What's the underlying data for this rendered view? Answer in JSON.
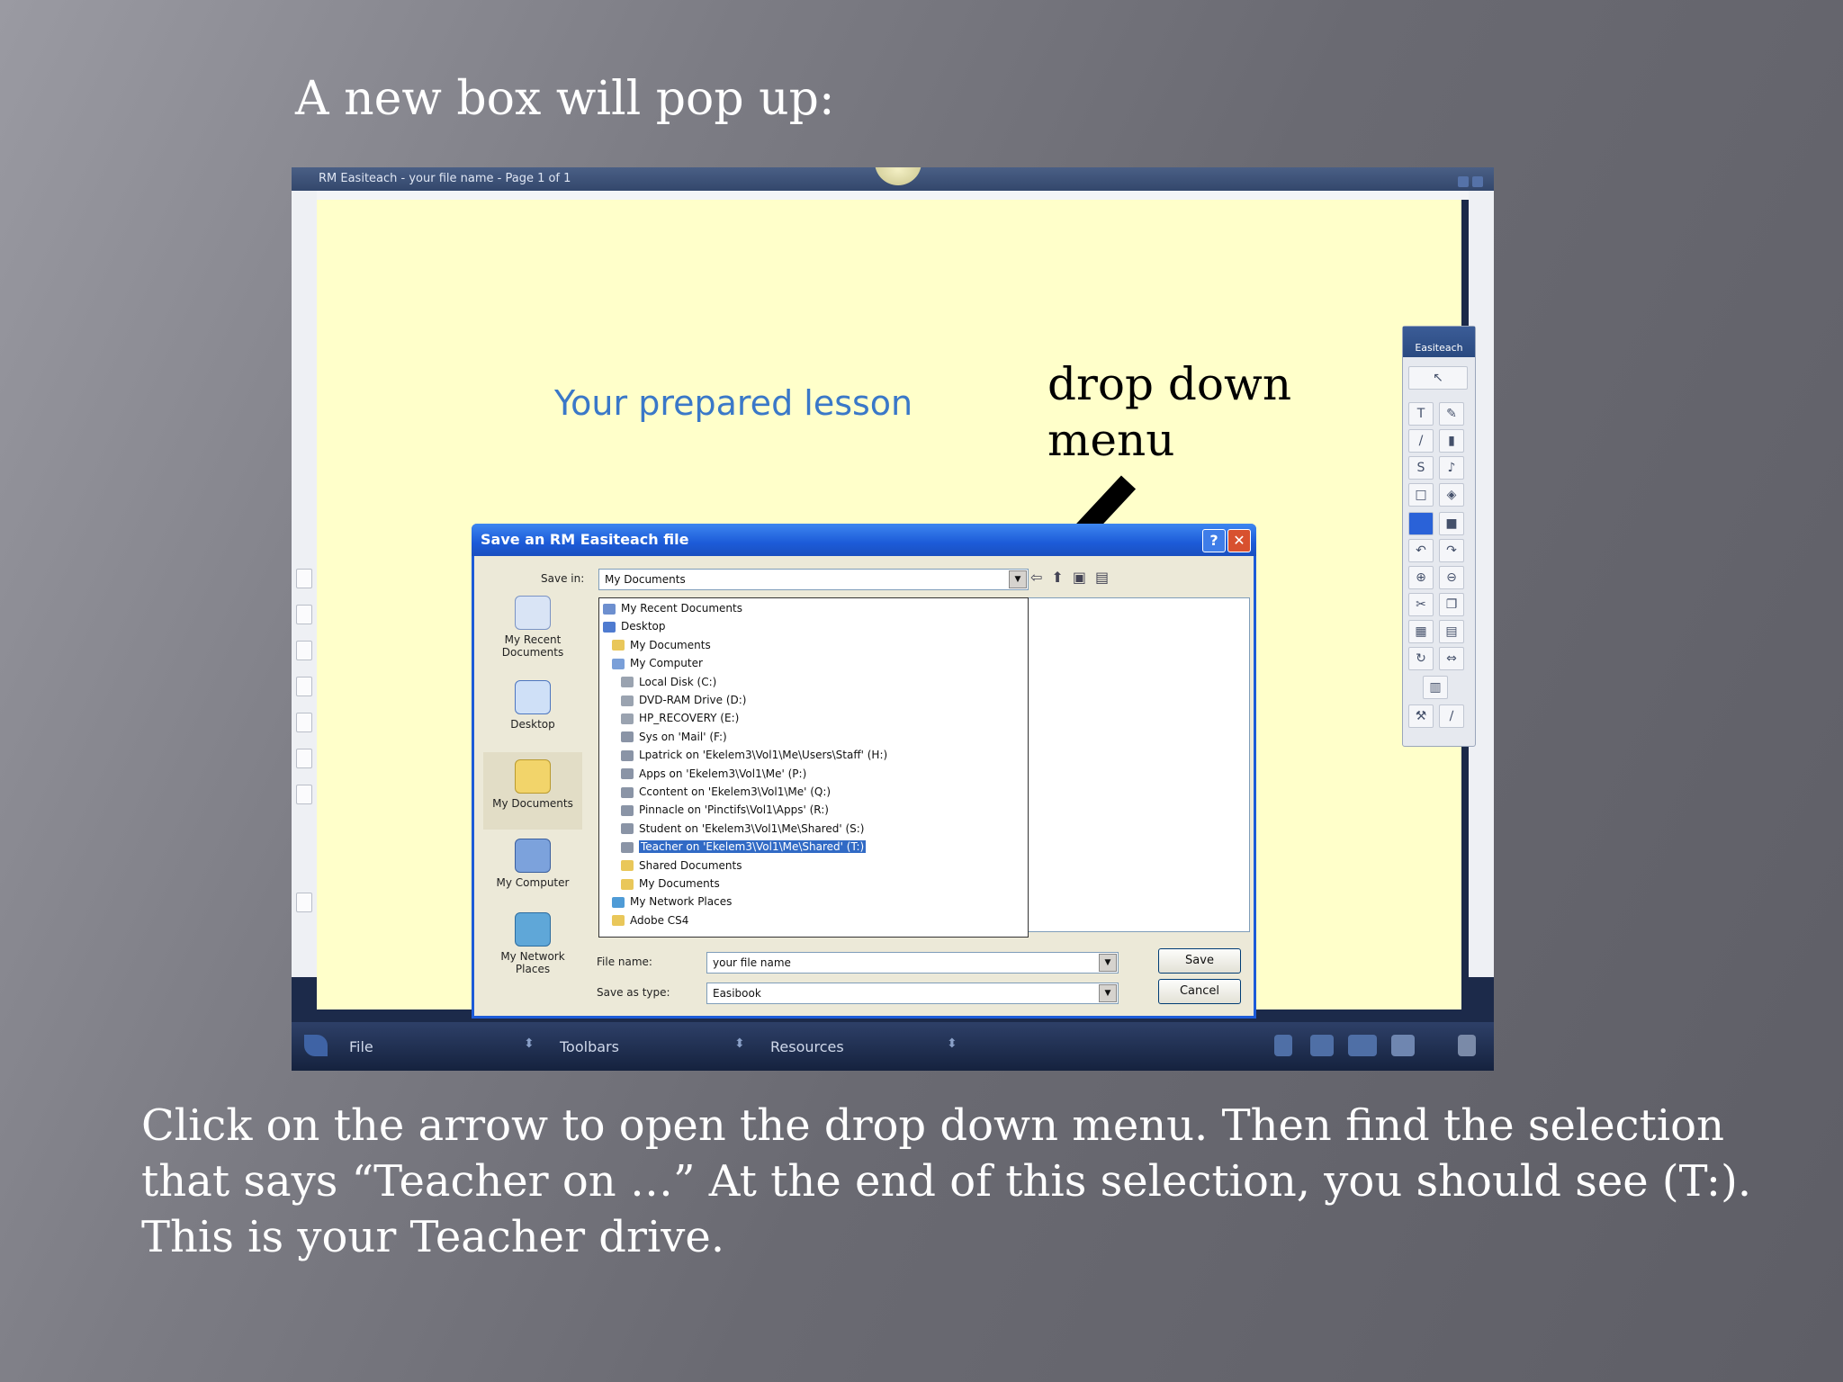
{
  "slide": {
    "title": "A new box will pop up:",
    "caption": [
      "Click on the arrow to open the drop down menu.  Then find the selection",
      "that says “Teacher on …”  At the end of this selection, you should see (T:).",
      "This is your Teacher drive."
    ]
  },
  "app": {
    "window_title": "RM Easiteach - your file name - Page 1 of 1",
    "lesson_text": "Your prepared lesson",
    "toolbox_title": "Easiteach"
  },
  "annotation": {
    "line1": "drop down",
    "line2": "menu"
  },
  "dialog": {
    "title": "Save an RM Easiteach file",
    "help_glyph": "?",
    "close_glyph": "✕",
    "save_in_label": "Save in:",
    "save_in_value": "My Documents",
    "places": [
      {
        "label1": "My Recent",
        "label2": "Documents"
      },
      {
        "label1": "Desktop",
        "label2": ""
      },
      {
        "label1": "My Documents",
        "label2": ""
      },
      {
        "label1": "My Computer",
        "label2": ""
      },
      {
        "label1": "My Network",
        "label2": "Places"
      }
    ],
    "dropdown_items": [
      "My Recent Documents",
      "Desktop",
      "My Documents",
      "My Computer",
      "Local Disk (C:)",
      "DVD-RAM Drive (D:)",
      "HP_RECOVERY (E:)",
      "Sys on 'Mail' (F:)",
      "Lpatrick on 'Ekelem3\\Vol1\\Me\\Users\\Staff' (H:)",
      "Apps on 'Ekelem3\\Vol1\\Me' (P:)",
      "Ccontent on 'Ekelem3\\Vol1\\Me' (Q:)",
      "Pinnacle on 'Pinctifs\\Vol1\\Apps' (R:)",
      "Student on 'Ekelem3\\Vol1\\Me\\Shared' (S:)",
      "Teacher on 'Ekelem3\\Vol1\\Me\\Shared' (T:)",
      "Shared Documents",
      "My Documents",
      "My Network Places",
      "Adobe CS4"
    ],
    "selected_index": 13,
    "file_name_label": "File name:",
    "file_name_value": "your file name",
    "save_type_label": "Save as type:",
    "save_type_value": "Easibook",
    "save_button": "Save",
    "cancel_button": "Cancel"
  },
  "taskbar": {
    "file": "File",
    "toolbars": "Toolbars",
    "resources": "Resources"
  },
  "colors": {
    "dialog_blue": "#1c5bd8",
    "selection": "#316ac5",
    "canvas": "#ffffca",
    "lesson_text": "#3a78c8"
  }
}
